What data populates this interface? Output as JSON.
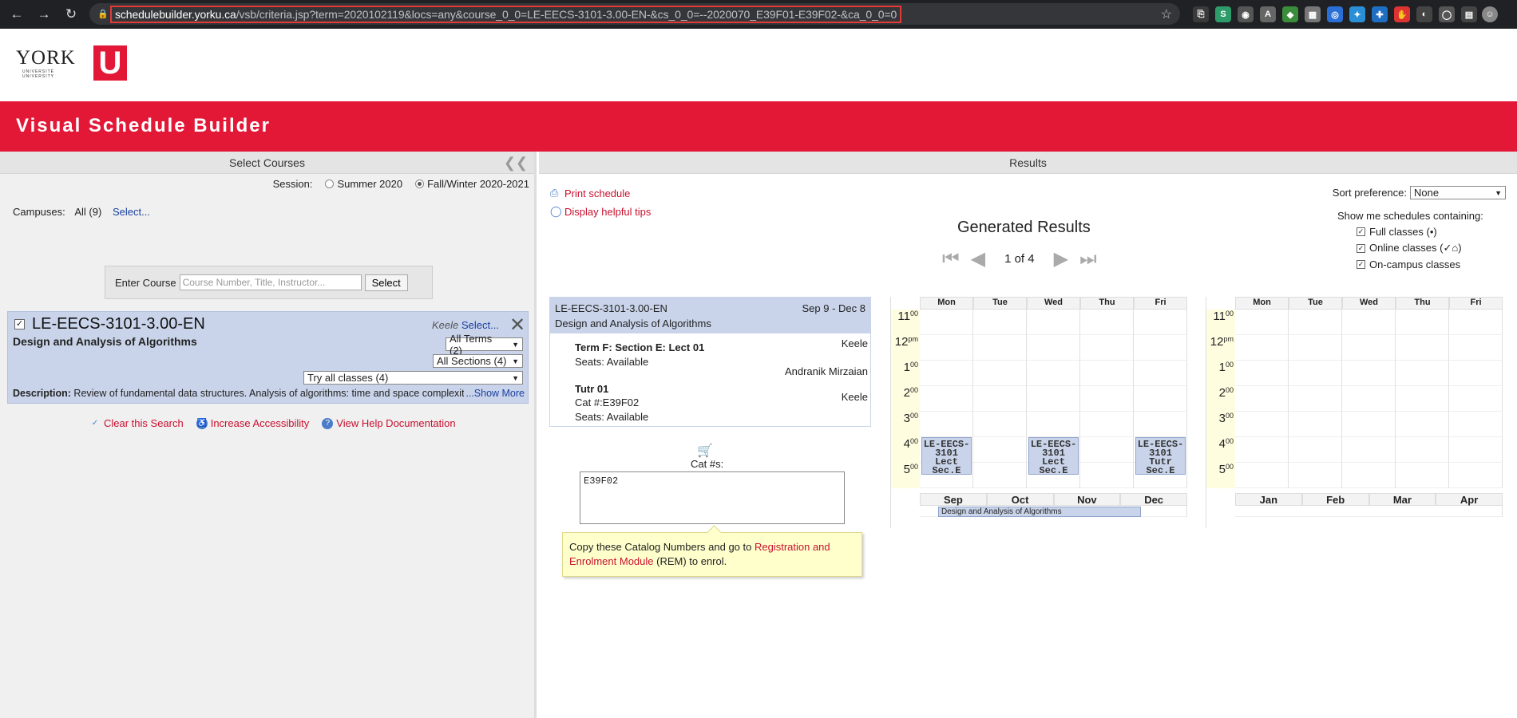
{
  "browser": {
    "url_host": "schedulebuilder.yorku.ca",
    "url_path": "/vsb/criteria.jsp?term=2020102119&locs=any&course_0_0=LE-EECS-3101-3.00-EN-&cs_0_0=--2020070_E39F01-E39F02-&ca_0_0=0"
  },
  "header": {
    "title": "Visual Schedule Builder",
    "logo_text": "YORK",
    "logo_sub": "UNIVERSITÉ UNIVERSITY",
    "logo_mark": "U"
  },
  "left": {
    "panel_title": "Select Courses",
    "session_label": "Session:",
    "session_options": [
      "Summer 2020",
      "Fall/Winter 2020-2021"
    ],
    "campuses_label": "Campuses:",
    "campuses_value": "All (9)",
    "campuses_select": "Select...",
    "enter_label": "Enter Course",
    "enter_placeholder": "Course Number, Title, Instructor...",
    "select_button": "Select",
    "course": {
      "code": "LE-EECS-3101-3.00-EN",
      "title": "Design and Analysis of Algorithms",
      "campus": "Keele",
      "select": "Select...",
      "terms": "All Terms (2)",
      "sections": "All Sections (4)",
      "classes": "Try all classes (4)",
      "desc_label": "Description:",
      "desc": "Review of fundamental data structures. Analysis of algorithms: time and space complexity",
      "show_more": "...Show More"
    },
    "links": [
      "Clear this Search",
      "Increase Accessibility",
      "View Help Documentation"
    ]
  },
  "right": {
    "panel_title": "Results",
    "print": "Print schedule",
    "tips": "Display helpful tips",
    "generated": "Generated Results",
    "page": "1 of 4",
    "sort_label": "Sort preference:",
    "sort_value": "None",
    "show_me": "Show me schedules containing:",
    "filters": [
      "Full classes (•)",
      "Online classes (✓⌂)",
      "On-campus classes"
    ],
    "card": {
      "code": "LE-EECS-3101-3.00-EN",
      "dates": "Sep 9 - Dec 8",
      "title": "Design and Analysis of Algorithms",
      "s1_name": "Term F: Section E: Lect 01",
      "s1_campus": "Keele",
      "s1_seats": "Seats: Available",
      "s1_instructor": "Andranik Mirzaian",
      "s2_name": "Tutr 01",
      "s2_campus": "Keele",
      "s2_cat": "Cat #:E39F02",
      "s2_seats": "Seats: Available"
    },
    "cat_label": "Cat #s:",
    "cat_value": "E39F02",
    "tip_pre": "Copy these Catalog Numbers and go to ",
    "tip_link": "Registration and Enrolment Module",
    "tip_post": " (REM) to enrol."
  },
  "calendar": {
    "days": [
      "Mon",
      "Tue",
      "Wed",
      "Thu",
      "Fri"
    ],
    "hours": [
      {
        "h": "11",
        "s": "00"
      },
      {
        "h": "12",
        "s": "pm"
      },
      {
        "h": "1",
        "s": "00"
      },
      {
        "h": "2",
        "s": "00"
      },
      {
        "h": "3",
        "s": "00"
      },
      {
        "h": "4",
        "s": "00"
      },
      {
        "h": "5",
        "s": "00"
      }
    ],
    "fall_months": [
      "Sep",
      "Oct",
      "Nov",
      "Dec"
    ],
    "winter_months": [
      "Jan",
      "Feb",
      "Mar",
      "Apr"
    ],
    "events": [
      {
        "day": "Mon",
        "text": "LE-EECS-\n3101\nLect\nSec.E"
      },
      {
        "day": "Wed",
        "text": "LE-EECS-\n3101\nLect\nSec.E"
      },
      {
        "day": "Fri",
        "text": "LE-EECS-\n3101\nTutr\nSec.E"
      }
    ],
    "term_bar": "Design and Analysis of Algorithms"
  }
}
